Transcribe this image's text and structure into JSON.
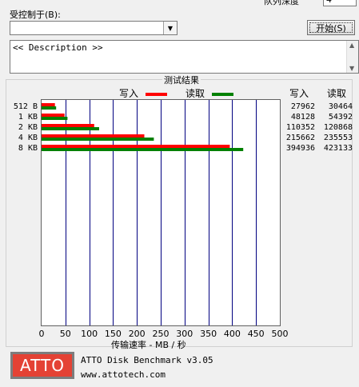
{
  "window": {
    "top_cut_label": "队列深度",
    "top_cut_value": "4"
  },
  "controls": {
    "controlled_by_label": "受控制于(B):",
    "controlled_by_value": "",
    "start_button_label": "开始(S)",
    "description_text": "<< Description >>"
  },
  "results": {
    "group_title": "测试结果",
    "legend_write": "写入",
    "legend_read": "读取",
    "col_write_header": "写入",
    "col_read_header": "读取",
    "rows": [
      {
        "size": "512 B",
        "write": "27962",
        "read": "30464"
      },
      {
        "size": "1 KB",
        "write": "48128",
        "read": "54392"
      },
      {
        "size": "2 KB",
        "write": "110352",
        "read": "120868"
      },
      {
        "size": "4 KB",
        "write": "215662",
        "read": "235553"
      },
      {
        "size": "8 KB",
        "write": "394936",
        "read": "423133"
      }
    ]
  },
  "colors": {
    "write": "#ff0000",
    "read": "#008000",
    "gridline": "#000080",
    "logo_bg": "#e44234"
  },
  "chart_data": {
    "type": "bar",
    "orientation": "horizontal",
    "categories": [
      "512 B",
      "1 KB",
      "2 KB",
      "4 KB",
      "8 KB"
    ],
    "series": [
      {
        "name": "写入",
        "values": [
          27.962,
          48.128,
          110.352,
          215.662,
          394.936
        ]
      },
      {
        "name": "读取",
        "values": [
          30.464,
          54.392,
          120.868,
          235.553,
          423.133
        ]
      }
    ],
    "xlabel": "传输速率 - MB / 秒",
    "xlim": [
      0,
      500
    ],
    "xticks": [
      0,
      50,
      100,
      150,
      200,
      250,
      300,
      350,
      400,
      450,
      500
    ],
    "grid": true,
    "legend": "top"
  },
  "footer": {
    "logo_text": "ATTO",
    "product_name": "ATTO Disk Benchmark v3.05",
    "url": "www.attotech.com"
  }
}
